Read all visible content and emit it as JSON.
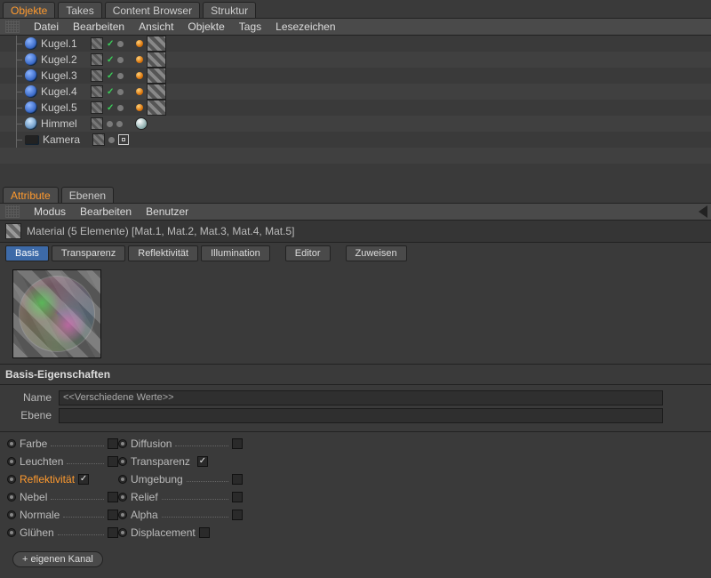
{
  "topTabs": {
    "t0": "Objekte",
    "t1": "Takes",
    "t2": "Content Browser",
    "t3": "Struktur"
  },
  "objMenu": {
    "m0": "Datei",
    "m1": "Bearbeiten",
    "m2": "Ansicht",
    "m3": "Objekte",
    "m4": "Tags",
    "m5": "Lesezeichen"
  },
  "treeItems": {
    "i0": "Kugel.1",
    "i1": "Kugel.2",
    "i2": "Kugel.3",
    "i3": "Kugel.4",
    "i4": "Kugel.5",
    "i5": "Himmel",
    "i6": "Kamera"
  },
  "attrTabs": {
    "t0": "Attribute",
    "t1": "Ebenen"
  },
  "attrMenu": {
    "m0": "Modus",
    "m1": "Bearbeiten",
    "m2": "Benutzer"
  },
  "matHeader": "Material (5 Elemente) [Mat.1, Mat.2, Mat.3, Mat.4, Mat.5]",
  "channelTabs": {
    "c0": "Basis",
    "c1": "Transparenz",
    "c2": "Reflektivität",
    "c3": "Illumination",
    "c4": "Editor",
    "c5": "Zuweisen"
  },
  "sectionTitle": "Basis-Eigenschaften",
  "form": {
    "nameLabel": "Name",
    "nameValue": "<<Verschiedene Werte>>",
    "layerLabel": "Ebene",
    "layerValue": ""
  },
  "channels": {
    "col0": {
      "r0": "Farbe",
      "r1": "Leuchten",
      "r2": "Reflektivität",
      "r3": "Nebel",
      "r4": "Normale",
      "r5": "Glühen"
    },
    "col1": {
      "r0": "Diffusion",
      "r1": "Transparenz",
      "r2": "Umgebung",
      "r3": "Relief",
      "r4": "Alpha",
      "r5": "Displacement"
    },
    "checks": {
      "reflektivitaet": "✓",
      "transparenz": "✓"
    }
  },
  "addChannel": "+ eigenen Kanal"
}
